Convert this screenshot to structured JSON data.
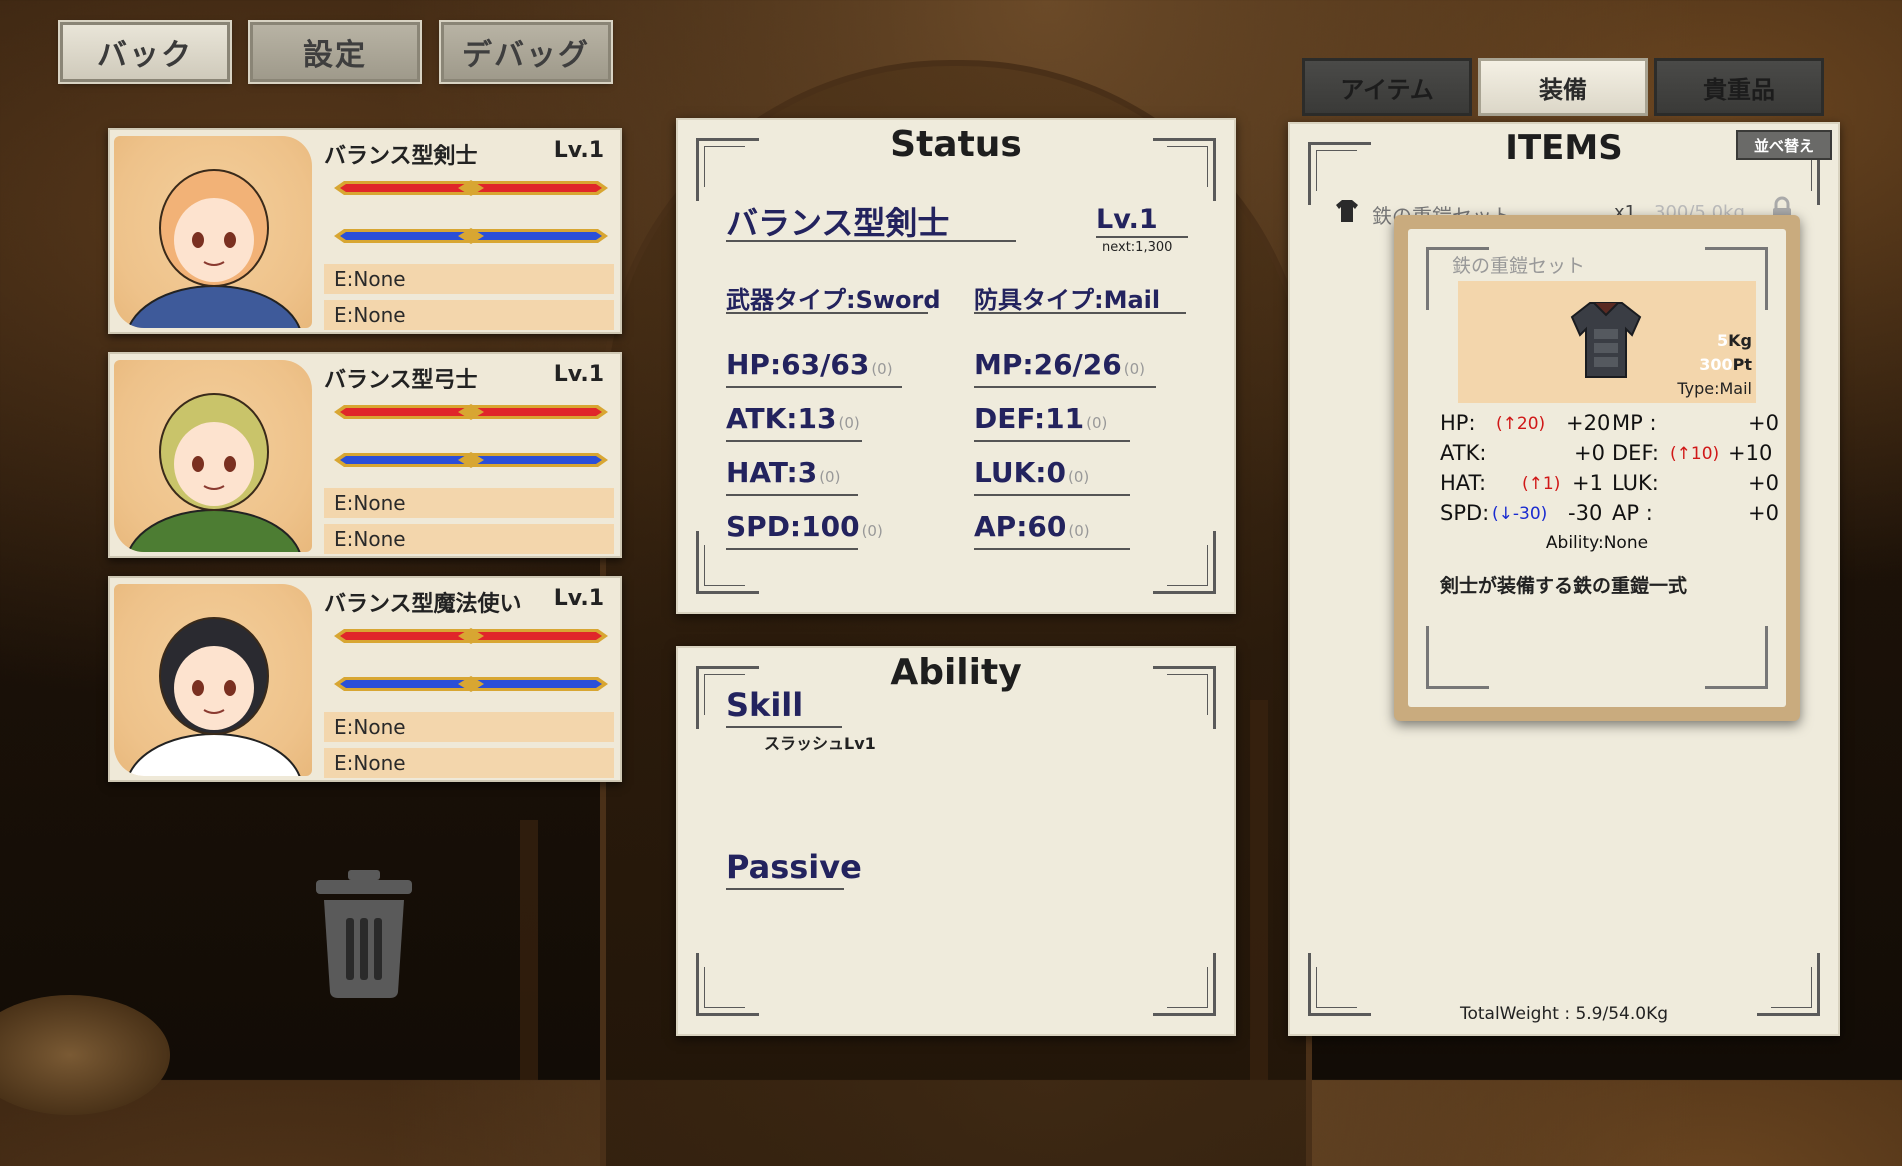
{
  "top_buttons": {
    "back": "バック",
    "settings": "設定",
    "debug": "デバッグ"
  },
  "characters": [
    {
      "name": "バランス型剣士",
      "level": "Lv.1",
      "equip1": "E:None",
      "equip2": "E:None",
      "hair": "#f2b277",
      "outfit": "#3e5a9a"
    },
    {
      "name": "バランス型弓士",
      "level": "Lv.1",
      "equip1": "E:None",
      "equip2": "E:None",
      "hair": "#c9c46a",
      "outfit": "#4d7d33"
    },
    {
      "name": "バランス型魔法使い",
      "level": "Lv.1",
      "equip1": "E:None",
      "equip2": "E:None",
      "hair": "#2a2a30",
      "outfit": "#ffffff"
    }
  ],
  "status": {
    "title": "Status",
    "name": "バランス型剣士",
    "level": "Lv.1",
    "next": "next:1,300",
    "weapon_type": "武器タイプ:Sword",
    "armor_type": "防具タイプ:Mail",
    "hp": "HP:63/63",
    "hp_bonus": "(0)",
    "mp": "MP:26/26",
    "mp_bonus": "(0)",
    "atk": "ATK:13",
    "atk_bonus": "(0)",
    "def": "DEF:11",
    "def_bonus": "(0)",
    "hat": "HAT:3",
    "hat_bonus": "(0)",
    "luk": "LUK:0",
    "luk_bonus": "(0)",
    "spd": "SPD:100",
    "spd_bonus": "(0)",
    "ap": "AP:60",
    "ap_bonus": "(0)"
  },
  "ability": {
    "title": "Ability",
    "skill_heading": "Skill",
    "skill_item": "スラッシュLv1",
    "passive_heading": "Passive"
  },
  "tabs": {
    "items": "アイテム",
    "equipment": "装備",
    "valuables": "貴重品"
  },
  "items_panel": {
    "title": "ITEMS",
    "sort_button": "並べ替え",
    "row": {
      "name": "鉄の重鎧セット",
      "count": "x1",
      "weight": "300/5.0kg"
    },
    "total_weight": "TotalWeight : 5.9/54.0Kg"
  },
  "item_detail": {
    "name": "鉄の重鎧セット",
    "weight_value": "5",
    "weight_unit": "Kg",
    "price_value": "300",
    "price_unit": "Pt",
    "type": "Type:Mail",
    "stats": {
      "hp_label": "HP:",
      "hp_change": "(↑20)",
      "hp_value": "+20",
      "mp_label": "MP :",
      "mp_value": "+0",
      "atk_label": "ATK:",
      "atk_value": "+0",
      "def_label": "DEF:",
      "def_change": "(↑10)",
      "def_value": "+10",
      "hat_label": "HAT:",
      "hat_change": "(↑1)",
      "hat_value": "+1",
      "luk_label": "LUK:",
      "luk_value": "+0",
      "spd_label": "SPD:",
      "spd_change": "(↓-30)",
      "spd_value": "-30",
      "ap_label": "AP :",
      "ap_value": "+0"
    },
    "ability": "Ability:None",
    "description": "剣士が装備する鉄の重鎧一式"
  },
  "colors": {
    "hp_bar": "#e0262a",
    "mp_bar": "#2b4fd8",
    "bar_frame": "#d8a632",
    "stat_text": "#23235e"
  }
}
